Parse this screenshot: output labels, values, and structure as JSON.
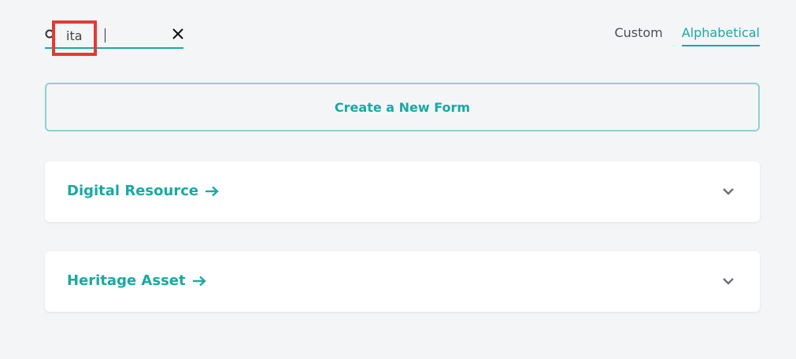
{
  "search": {
    "value": "ita",
    "placeholder": ""
  },
  "sort": {
    "tabs": [
      {
        "label": "Custom",
        "active": false
      },
      {
        "label": "Alphabetical",
        "active": true
      }
    ]
  },
  "create_button": {
    "label": "Create a New Form"
  },
  "forms": [
    {
      "name": "Digital Resource"
    },
    {
      "name": "Heritage Asset"
    }
  ],
  "colors": {
    "accent": "#17aaa3",
    "background": "#f4f5f7",
    "highlight": "#e53935"
  },
  "icons": {
    "search": "search-icon",
    "clear": "close-icon",
    "arrow": "arrow-right-icon",
    "chevron": "chevron-down-icon"
  }
}
